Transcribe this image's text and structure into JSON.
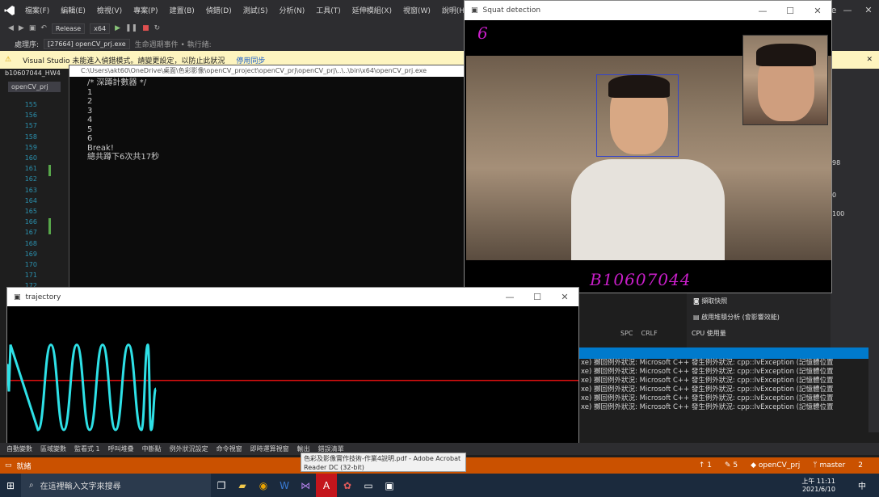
{
  "vs": {
    "menus": [
      "檔案(F)",
      "編輯(E)",
      "檢視(V)",
      "專案(P)",
      "建置(B)",
      "偵錯(D)",
      "測試(S)",
      "分析(N)",
      "工具(T)",
      "延伸模組(X)",
      "視窗(W)",
      "說明(H)"
    ],
    "config": "Release",
    "platform": "x64",
    "process_label": "處理序:",
    "process_value": "[27664] openCV_prj.exe",
    "lifecycle": "生命週期事件 • 執行緒:",
    "infobar_text": "Visual Studio 未能進入偵錯模式。請變更設定，以防止此狀況",
    "infobar_link": "停用同步",
    "project_tab": "b10607044_HW4",
    "project_name": "openCV_prj",
    "share": "hare",
    "line_numbers": [
      "155",
      "156",
      "157",
      "158",
      "159",
      "160",
      "161",
      "162",
      "163",
      "164",
      "165",
      "166",
      "167",
      "168",
      "169",
      "170",
      "171",
      "172"
    ]
  },
  "console": {
    "path": "C:\\Users\\akt60\\OneDrive\\桌面\\色彩影像\\openCV_project\\openCV_prj\\openCV_prj\\..\\..\\bin\\x64\\openCV_prj.exe",
    "lines": [
      "/* 深蹲計數器 */",
      "1",
      "2",
      "3",
      "4",
      "5",
      "6",
      "Break!",
      "總共蹲下6次共17秒"
    ]
  },
  "squat": {
    "title": "Squat detection",
    "count": "6",
    "student_id": "B10607044"
  },
  "trajectory": {
    "title": "trajectory"
  },
  "chart_data": {
    "type": "line",
    "series": [
      {
        "values": [
          0.58,
          0.38,
          0.72,
          0.1,
          0.72,
          0.1,
          0.72,
          0.1,
          0.72,
          0.1,
          0.72,
          0.1,
          0.72,
          0.1,
          0.4
        ]
      }
    ],
    "threshold": 0.46,
    "colors": {
      "line": "#2ee0e6",
      "threshold": "#e01010",
      "background": "#000000"
    }
  },
  "right": {
    "panel_values": [
      "98",
      "0",
      "100"
    ],
    "cpu_label": "CPU 使用量",
    "menu_items": [
      "擷取快照",
      "啟用堆積分析 (會影響效能)"
    ],
    "status": [
      "SPC",
      "CRLF"
    ]
  },
  "output": {
    "lines": [
      "xe) 擲回例外狀況: Microsoft C++ 發生例外狀況: cpp::IvException (記憶體位置",
      "xe) 擲回例外狀況: Microsoft C++ 發生例外狀況: cpp::IvException (記憶體位置",
      "xe) 擲回例外狀況: Microsoft C++ 發生例外狀況: cpp::IvException (記憶體位置",
      "xe) 擲回例外狀況: Microsoft C++ 發生例外狀況: cpp::IvException (記憶體位置",
      "xe) 擲回例外狀況: Microsoft C++ 發生例外狀況: cpp::IvException (記憶體位置",
      "xe) 擲回例外狀況: Microsoft C++ 發生例外狀況: cpp::IvException (記憶體位置"
    ]
  },
  "bottom_tabs": [
    "自動變數",
    "區域變數",
    "監看式 1",
    "呼叫堆疊",
    "中斷點",
    "例外狀況設定",
    "命令視窗",
    "即時運算視窗",
    "輸出",
    "錯誤清單"
  ],
  "status": {
    "ready": "就緒",
    "up": "1",
    "edits": "5",
    "repo": "openCV_prj",
    "branch": "master",
    "badge": "2"
  },
  "tooltip": "色彩及影像實作技術-作業4說明.pdf - Adobe Acrobat Reader DC (32-bit)",
  "taskbar": {
    "search_placeholder": "在這裡輸入文字來搜尋",
    "time": "上午 11:11",
    "date": "2021/6/10",
    "ime": "中"
  }
}
